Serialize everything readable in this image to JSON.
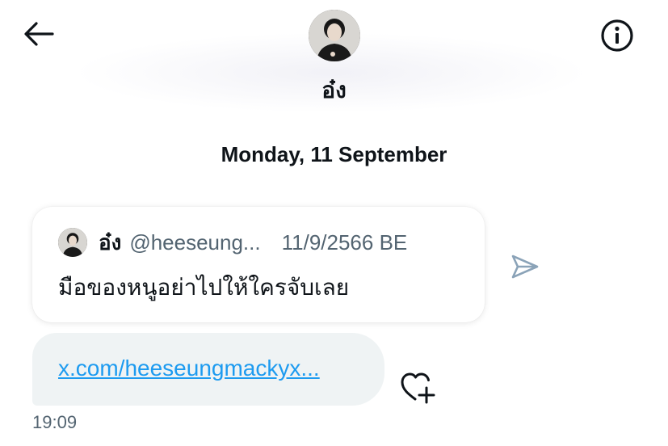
{
  "header": {
    "back_icon": "arrow-left-icon",
    "info_icon": "info-circle-icon",
    "contact_name": "อ๋ง"
  },
  "conversation": {
    "date_divider": "Monday, 11 September",
    "quoted_post": {
      "author_name": "อ๋ง",
      "author_handle": "@heeseung...",
      "post_date": "11/9/2566 BE",
      "text": "มือของหนูอย่าไปให้ใครจับเลย"
    },
    "share_icon": "send-icon",
    "link_message": {
      "text": "x.com/heeseungmackyx..."
    },
    "reaction_icon": "heart-plus-icon",
    "timestamp": "19:09"
  },
  "colors": {
    "text_primary": "#0f1419",
    "text_secondary": "#536471",
    "link": "#1d9bf0",
    "bubble_bg": "#eff3f4",
    "icon_muted": "#8ba3b8"
  }
}
